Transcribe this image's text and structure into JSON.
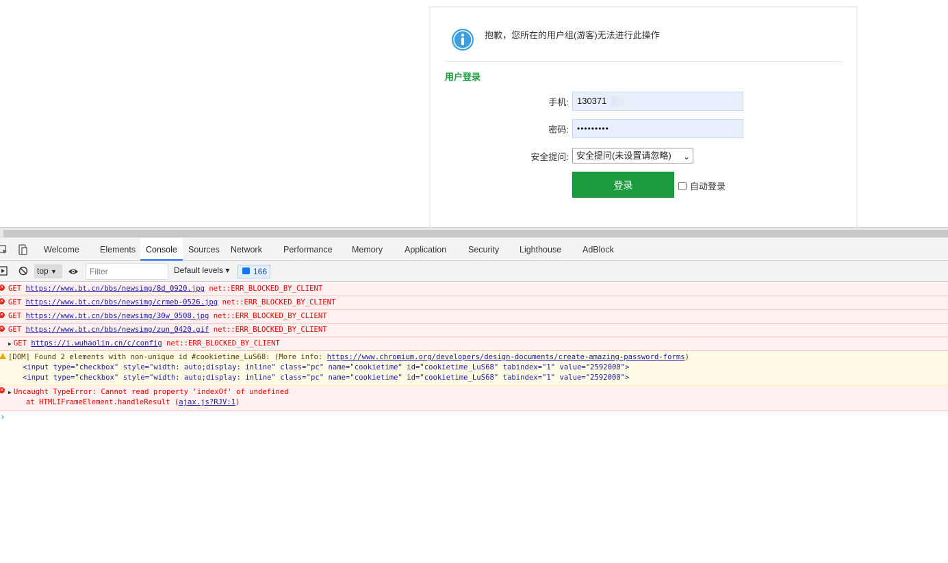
{
  "page": {
    "notice": "抱歉，您所在的用户组(游客)无法进行此操作",
    "login_title": "用户登录",
    "phone_label": "手机:",
    "phone_value": "130371",
    "password_label": "密码:",
    "password_value": "•••••••••",
    "question_label": "安全提问:",
    "question_value": "安全提问(未设置请忽略)",
    "login_button": "登录",
    "auto_login": "自动登录"
  },
  "devtools": {
    "tabs": [
      "Welcome",
      "Elements",
      "Console",
      "Sources",
      "Network",
      "Performance",
      "Memory",
      "Application",
      "Security",
      "Lighthouse",
      "AdBlock"
    ],
    "active_tab": "Console",
    "context": "top",
    "filter_placeholder": "Filter",
    "levels": "Default levels ▾",
    "message_count": "166"
  },
  "console": {
    "errors": [
      {
        "method": "GET",
        "url": "https://www.bt.cn/bbs/newsimg/8d_0920.jpg",
        "status": "net::ERR_BLOCKED_BY_CLIENT"
      },
      {
        "method": "GET",
        "url": "https://www.bt.cn/bbs/newsimg/crmeb-0526.jpg",
        "status": "net::ERR_BLOCKED_BY_CLIENT"
      },
      {
        "method": "GET",
        "url": "https://www.bt.cn/bbs/newsimg/30w_0508.jpg",
        "status": "net::ERR_BLOCKED_BY_CLIENT"
      },
      {
        "method": "GET",
        "url": "https://www.bt.cn/bbs/newsimg/zun_0420.gif",
        "status": "net::ERR_BLOCKED_BY_CLIENT"
      },
      {
        "method": "GET",
        "url": "https://i.wuhaolin.cn/c/config",
        "status": "net::ERR_BLOCKED_BY_CLIENT"
      }
    ],
    "warning": {
      "text": "[DOM] Found 2 elements with non-unique id #cookietime_LuS68: (More info: ",
      "link": "https://www.chromium.org/developers/design-documents/create-amazing-password-forms",
      "close": ")",
      "line1": "<input type=\"checkbox\" style=\"width: auto;display: inline\" class=\"pc\" name=\"cookietime\" id=\"cookietime_LuS68\" tabindex=\"1\" value=\"2592000\">",
      "line2": "<input type=\"checkbox\" style=\"width: auto;display: inline\" class=\"pc\" name=\"cookietime\" id=\"cookietime_LuS68\" tabindex=\"1\" value=\"2592000\">"
    },
    "type_error": {
      "text": "Uncaught TypeError: Cannot read property 'indexOf' of undefined",
      "stack_prefix": "at HTMLIFrameElement.handleResult (",
      "stack_link": "ajax.js?RJV:1",
      "stack_suffix": ")"
    },
    "prompt": "›"
  },
  "colors": {
    "green": "#1a9b3d",
    "error_bg": "#fff0f0",
    "warning_bg": "#fffbe5",
    "accent": "#1a73e8"
  }
}
